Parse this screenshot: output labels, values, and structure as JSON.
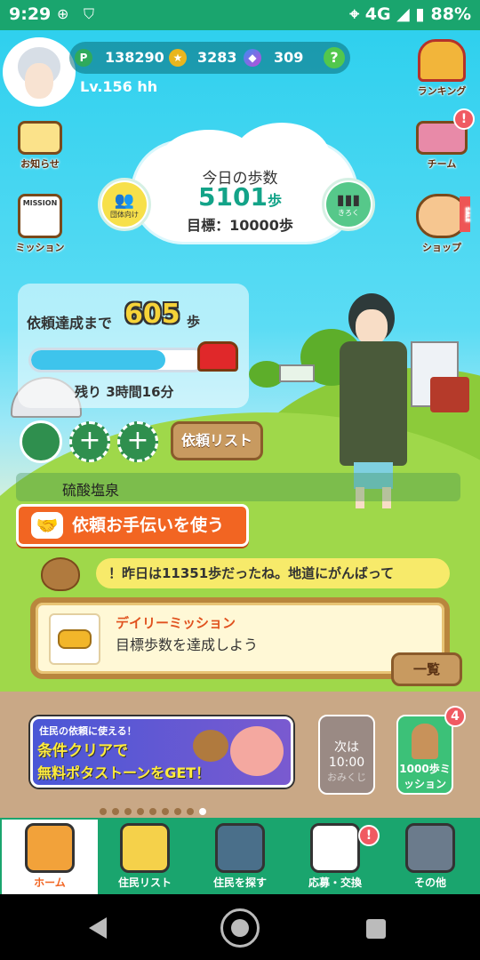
{
  "status_bar": {
    "time": "9:29",
    "network": "4G",
    "battery": "88%"
  },
  "user": {
    "level": "Lv.156 hh"
  },
  "currency": {
    "points": "138290",
    "coins": "3283",
    "gems": "309",
    "points_icon": "P",
    "help_icon": "?"
  },
  "side_left": {
    "news": "お知らせ",
    "mission": "ミッション",
    "mission_tag": "MISSION"
  },
  "side_right": {
    "ranking": "ランキング",
    "team": "チーム",
    "shop": "ショップ",
    "team_badge": "!",
    "sale_tag": "SALE"
  },
  "steps": {
    "title": "今日の歩数",
    "value": "5101",
    "unit": "歩",
    "goal": "目標：10000歩",
    "group_label": "団体向け",
    "record_label": "きろく"
  },
  "request": {
    "label": "依頼達成まで",
    "remaining_steps": "605",
    "unit": "歩",
    "time_left": "残り 3時間16分",
    "progress": 0.78,
    "list_button": "依頼リスト",
    "plus": "+"
  },
  "spa": {
    "label": "硫酸塩泉"
  },
  "help_button": {
    "label": "依頼お手伝いを使う"
  },
  "speech": {
    "text": "！昨日は11351歩だったね。地道にがんばって"
  },
  "daily_mission": {
    "title": "デイリーミッション",
    "description": "目標歩数を達成しよう",
    "more_button": "一覧"
  },
  "banner": {
    "line1": "住民の依頼に使える！",
    "line2": "条件クリアで",
    "line3": "無料ポタストーンをGET！"
  },
  "omikuji": {
    "line1": "次は",
    "time": "10:00",
    "label": "おみくじ"
  },
  "mission1000": {
    "label": "1000歩ミッション",
    "badge": "4"
  },
  "carousel": {
    "count": 9,
    "active_index": 8
  },
  "bottom_nav": [
    {
      "label": "ホーム",
      "icon": "house-icon"
    },
    {
      "label": "住民リスト",
      "icon": "notebook-icon"
    },
    {
      "label": "住民を探す",
      "icon": "binoculars-icon",
      "badge": ""
    },
    {
      "label": "応募・交換",
      "icon": "gift-icon",
      "badge": "!"
    },
    {
      "label": "その他",
      "icon": "gear-icon"
    }
  ]
}
